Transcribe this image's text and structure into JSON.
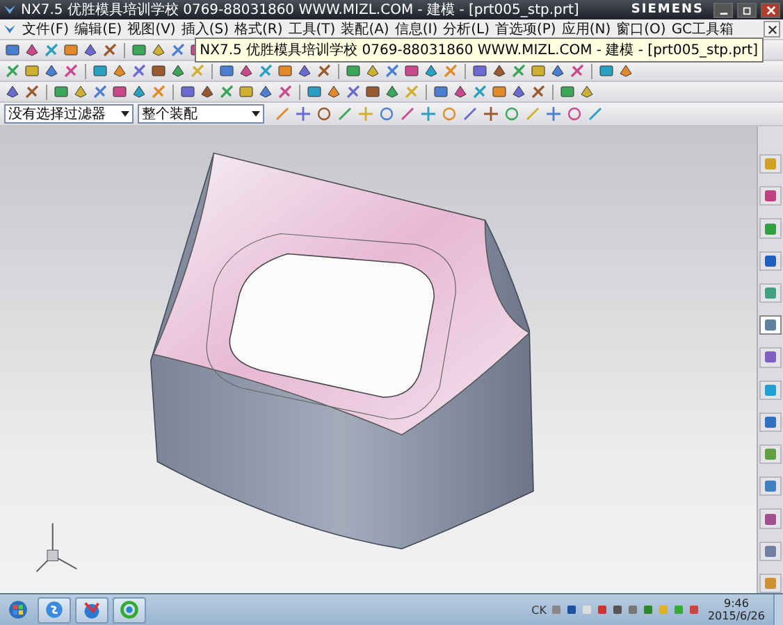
{
  "title_bar": {
    "title": "NX7.5  优胜模具培训学校  0769-88031860  WWW.MIZL.COM - 建模 - [prt005_stp.prt]",
    "brand": "SIEMENS"
  },
  "menu_bar": {
    "items": [
      "文件(F)",
      "编辑(E)",
      "视图(V)",
      "插入(S)",
      "格式(R)",
      "工具(T)",
      "装配(A)",
      "信息(I)",
      "分析(L)",
      "首选项(P)",
      "应用(N)",
      "窗口(O)",
      "GC工具箱"
    ]
  },
  "tooltip": {
    "text": "NX7.5  优胜模具培训学校  0769-88031860  WWW.MIZL.COM - 建模 - [prt005_stp.prt]"
  },
  "selection_bar": {
    "filter": "没有选择过滤器",
    "scope": "整个装配"
  },
  "resource_tabs": [
    {
      "selected": false
    },
    {
      "selected": false
    },
    {
      "selected": false
    },
    {
      "selected": false
    },
    {
      "selected": false
    },
    {
      "selected": true
    },
    {
      "selected": false
    },
    {
      "selected": false
    },
    {
      "selected": false
    },
    {
      "selected": false
    },
    {
      "selected": false
    },
    {
      "selected": false
    },
    {
      "selected": false
    },
    {
      "selected": false
    }
  ],
  "taskbar": {
    "language": "CK",
    "time": "9:46",
    "date": "2015/6/26"
  }
}
